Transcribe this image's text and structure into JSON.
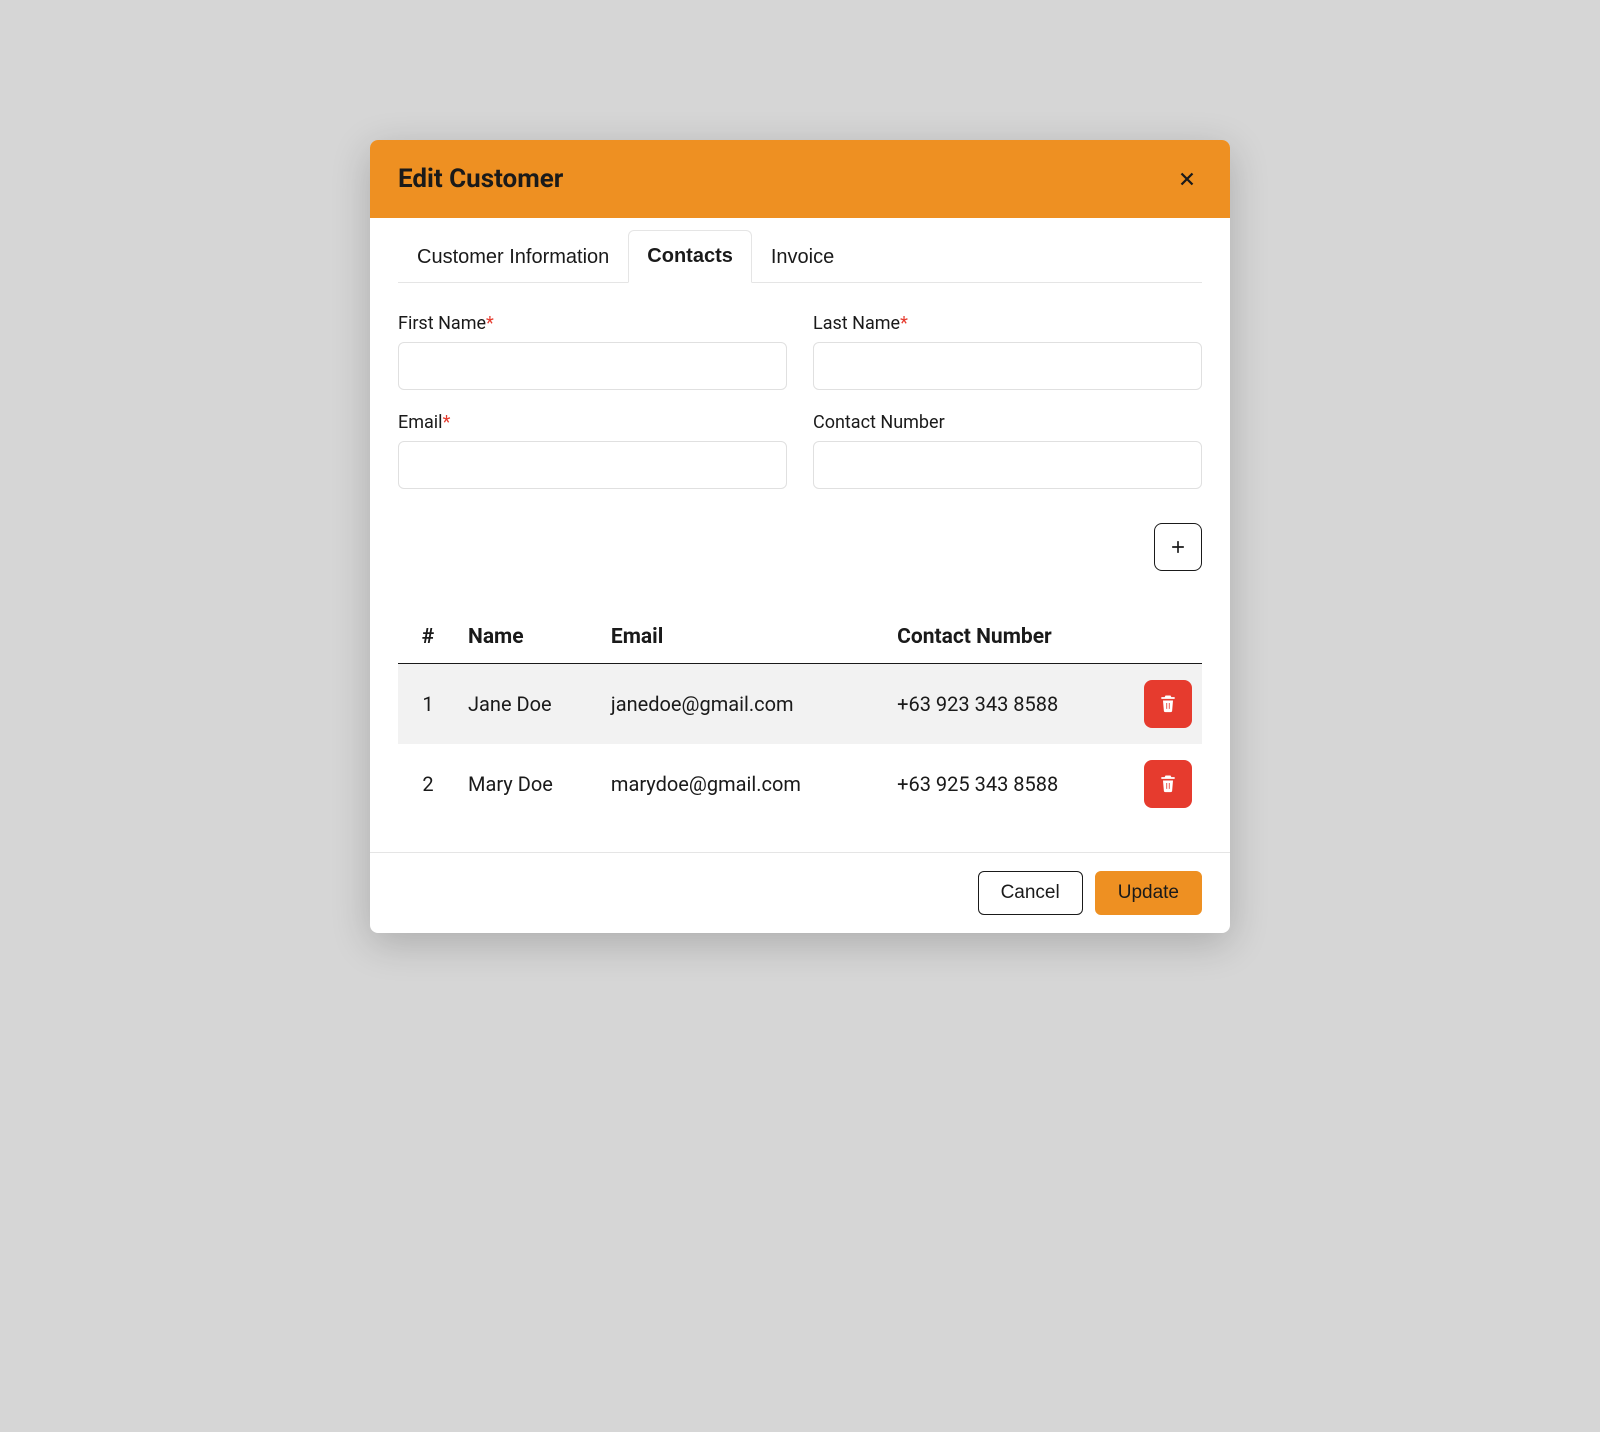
{
  "modal": {
    "title": "Edit Customer"
  },
  "tabs": [
    {
      "label": "Customer Information",
      "active": false
    },
    {
      "label": "Contacts",
      "active": true
    },
    {
      "label": "Invoice",
      "active": false
    }
  ],
  "form": {
    "first_name": {
      "label": "First Name",
      "required": true,
      "value": ""
    },
    "last_name": {
      "label": "Last Name",
      "required": true,
      "value": ""
    },
    "email": {
      "label": "Email",
      "required": true,
      "value": ""
    },
    "contact_number": {
      "label": "Contact Number",
      "required": false,
      "value": ""
    }
  },
  "table": {
    "headers": {
      "index": "#",
      "name": "Name",
      "email": "Email",
      "contact_number": "Contact Number"
    },
    "rows": [
      {
        "index": "1",
        "name": "Jane Doe",
        "email": "janedoe@gmail.com",
        "contact_number": "+63 923 343 8588"
      },
      {
        "index": "2",
        "name": "Mary Doe",
        "email": "marydoe@gmail.com",
        "contact_number": "+63 925 343 8588"
      }
    ]
  },
  "footer": {
    "cancel_label": "Cancel",
    "update_label": "Update"
  },
  "required_marker": "*"
}
